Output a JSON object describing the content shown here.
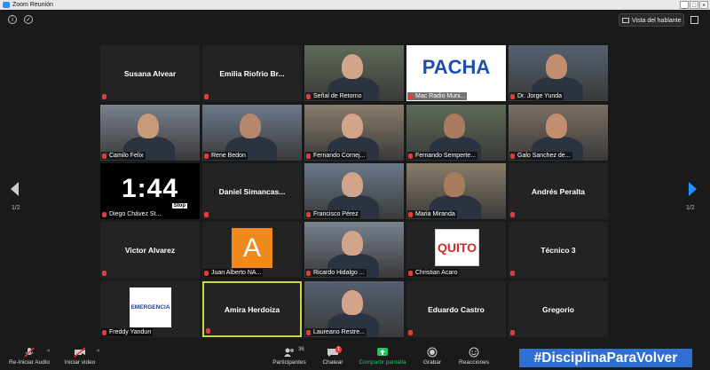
{
  "window": {
    "title": "Zoom Reunión"
  },
  "topbar": {
    "speaker_view": "Vista del hablante"
  },
  "pagination": {
    "left": "1/2",
    "right": "1/2"
  },
  "participants": [
    {
      "name": "Susana Alvear",
      "mode": "name"
    },
    {
      "name": "Emilia Riofrio Br...",
      "mode": "name"
    },
    {
      "name": "Señal de Retorno",
      "mode": "video"
    },
    {
      "name": "Mac Radio Muni...",
      "mode": "video",
      "logo": "PACHA"
    },
    {
      "name": "Dr. Jorge Yunda",
      "mode": "video"
    },
    {
      "name": "Camilo Felix",
      "mode": "video"
    },
    {
      "name": "Rene Bedon",
      "mode": "video"
    },
    {
      "name": "Fernando Cornej...",
      "mode": "video"
    },
    {
      "name": "Fernando Semperte...",
      "mode": "video"
    },
    {
      "name": "Galo Sanchez de...",
      "mode": "video"
    },
    {
      "name": "Diego Chávez St...",
      "mode": "timer",
      "clock": "1:44",
      "stop": "Stop"
    },
    {
      "name": "Daniel  Simancas...",
      "mode": "name"
    },
    {
      "name": "Francisco Pérez",
      "mode": "video"
    },
    {
      "name": "Maria Miranda",
      "mode": "video"
    },
    {
      "name": "Andrés Peralta",
      "mode": "name"
    },
    {
      "name": "Victor Alvarez",
      "mode": "name"
    },
    {
      "name": "Juan Alberto NA...",
      "mode": "avatar",
      "initial": "A"
    },
    {
      "name": "Ricardo Hidalgo ...",
      "mode": "video"
    },
    {
      "name": "Christian Acaro",
      "mode": "video",
      "logo": "QUITO"
    },
    {
      "name": "Técnico 3",
      "mode": "name"
    },
    {
      "name": "Freddy Yandun",
      "mode": "video",
      "logo": "EMERGENCIA"
    },
    {
      "name": "Amira Herdoiza",
      "mode": "name",
      "active": true
    },
    {
      "name": "Laureano Restre...",
      "mode": "video"
    },
    {
      "name": "Eduardo Castro",
      "mode": "name"
    },
    {
      "name": "Gregorio",
      "mode": "name"
    }
  ],
  "toolbar": {
    "audio": "Re-Iniciar Audio",
    "video": "Iniciar video",
    "participants": "Participantes",
    "participants_count": "36",
    "chat": "Chatear",
    "chat_badge": "1",
    "share": "Compartir pantalla",
    "record": "Grabar",
    "reactions": "Reacciones"
  },
  "overlay": {
    "hashtag": "#DisciplinaParaVolver"
  },
  "colors": {
    "accent": "#1e90ff",
    "share_green": "#22c55e",
    "muted_red": "#e23c3c",
    "active_border": "#c9d64a"
  }
}
